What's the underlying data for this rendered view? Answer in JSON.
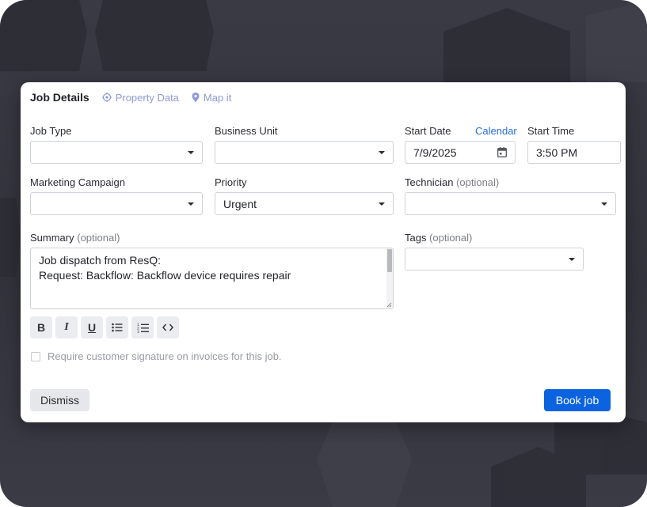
{
  "tabs": {
    "title": "Job Details",
    "property_data": "Property Data",
    "map_it": "Map it"
  },
  "fields": {
    "job_type": {
      "label": "Job Type",
      "value": ""
    },
    "business_unit": {
      "label": "Business Unit",
      "value": ""
    },
    "start_date": {
      "label": "Start Date",
      "calendar_link": "Calendar",
      "value": "7/9/2025"
    },
    "start_time": {
      "label": "Start Time",
      "value": "3:50 PM"
    },
    "marketing_campaign": {
      "label": "Marketing Campaign",
      "value": ""
    },
    "priority": {
      "label": "Priority",
      "value": "Urgent"
    },
    "technician": {
      "label": "Technician",
      "optional": "(optional)",
      "value": ""
    },
    "summary": {
      "label": "Summary",
      "optional": "(optional)",
      "value": "Job dispatch from ResQ:\nRequest: Backflow: Backflow device requires repair"
    },
    "tags": {
      "label": "Tags",
      "optional": "(optional)",
      "value": ""
    }
  },
  "toolbar": {
    "bold": "B",
    "italic": "I",
    "underline": "U"
  },
  "signature": {
    "label": "Require customer signature on invoices for this job.",
    "checked": false
  },
  "buttons": {
    "dismiss": "Dismiss",
    "book": "Book job"
  },
  "colors": {
    "accent": "#0b63e0",
    "link": "#2a6fd8",
    "tab_link": "#8f9ad6",
    "backdrop": "#36363f"
  }
}
